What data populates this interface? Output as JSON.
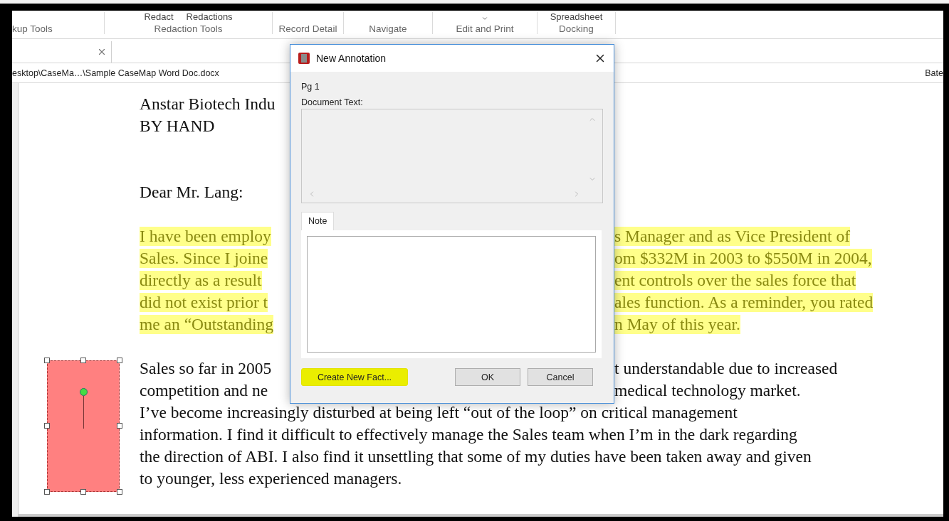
{
  "ribbon": {
    "groups": [
      {
        "label": "kup Tools",
        "menu_caret": false
      },
      {
        "label": "Redaction Tools",
        "buttons": [
          "Redact",
          "Redactions"
        ],
        "menu_caret": false
      },
      {
        "label": "Record Detail",
        "menu_caret": false
      },
      {
        "label": "Navigate",
        "menu_caret": false
      },
      {
        "label": "Edit and Print",
        "menu_caret": true
      },
      {
        "label": "Docking",
        "buttons": [
          "Spreadsheet"
        ],
        "menu_caret": false
      }
    ]
  },
  "document_tab": {
    "selected": true
  },
  "path_bar": {
    "path": "esktop\\CaseMa…\\Sample CaseMap Word Doc.docx",
    "right_label": "Bate"
  },
  "document": {
    "paragraphs": [
      {
        "highlighted": false,
        "lines": [
          {
            "left": "Anstar Biotech Indu"
          },
          {
            "text": "BY HAND"
          }
        ]
      },
      {
        "highlighted": false,
        "lines": [
          {
            "text": "Dear Mr. Lang:"
          }
        ]
      },
      {
        "highlighted": true,
        "lines": [
          {
            "left": "I have been employ",
            "right": "s Manager and as Vice President of"
          },
          {
            "left": "Sales. Since I joine",
            "right": "om $332M in 2003 to $550M in 2004,"
          },
          {
            "left": "directly as a result",
            "right": "ent controls over the sales force that"
          },
          {
            "left": "did not exist prior t",
            "right": "ales function. As a reminder, you rated"
          },
          {
            "left": "me an “Outstanding",
            "right": "n May of this year."
          }
        ]
      },
      {
        "highlighted": false,
        "lines": [
          {
            "left": "Sales so far in 2005",
            "right": "t understandable due to increased"
          },
          {
            "left": "competition and ne",
            "right": "medical technology market."
          },
          {
            "text": "I’ve become increasingly disturbed at being left “out of the loop” on critical management"
          },
          {
            "text": "information. I find it difficult to effectively manage the Sales team when I’m in the dark regarding"
          },
          {
            "text": "the direction of ABI. I also find it unsettling that some of my duties have been taken away and given"
          },
          {
            "text": "to younger, less experienced managers."
          }
        ]
      }
    ],
    "annotation": {
      "selected": true,
      "color": "#ff8080"
    }
  },
  "dialog": {
    "title": "New Annotation",
    "page": "Pg 1",
    "document_text_label": "Document Text:",
    "document_text_disabled": true,
    "tabs": [
      {
        "label": "Note",
        "selected": true
      }
    ],
    "buttons": [
      {
        "label": "Create New Fact...",
        "highlighted": true
      },
      {
        "label": "OK",
        "highlighted": false
      },
      {
        "label": "Cancel",
        "highlighted": false
      }
    ]
  }
}
